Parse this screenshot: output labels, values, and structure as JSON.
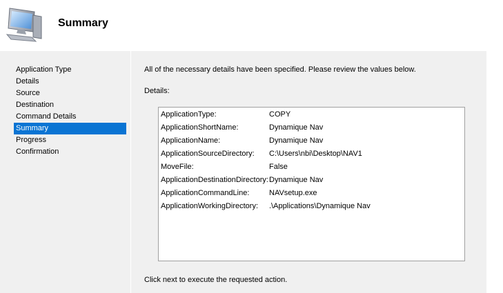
{
  "header": {
    "title": "Summary",
    "icon": "computer-monitor-icon"
  },
  "sidebar": {
    "items": [
      {
        "label": "Application Type"
      },
      {
        "label": "Details"
      },
      {
        "label": "Source"
      },
      {
        "label": "Destination"
      },
      {
        "label": "Command Details"
      },
      {
        "label": "Summary"
      },
      {
        "label": "Progress"
      },
      {
        "label": "Confirmation"
      }
    ],
    "active_index": 5
  },
  "main": {
    "intro_text": "All of the necessary details have been specified.  Please review the values below.",
    "details_label": "Details:",
    "details": [
      {
        "key": "ApplicationType:",
        "value": "COPY"
      },
      {
        "key": "ApplicationShortName:",
        "value": "Dynamique Nav"
      },
      {
        "key": "ApplicationName:",
        "value": "Dynamique Nav"
      },
      {
        "key": "ApplicationSourceDirectory:",
        "value": "C:\\Users\\nbi\\Desktop\\NAV1"
      },
      {
        "key": "MoveFile:",
        "value": "False"
      },
      {
        "key": "ApplicationDestinationDirectory:",
        "value": "Dynamique Nav"
      },
      {
        "key": "ApplicationCommandLine:",
        "value": "NAVsetup.exe"
      },
      {
        "key": "ApplicationWorkingDirectory:",
        "value": ".\\Applications\\Dynamique Nav"
      }
    ],
    "footer_text": "Click next to execute the requested action."
  },
  "colors": {
    "selection": "#0a74d3",
    "panel_background": "#f0f0f0"
  }
}
